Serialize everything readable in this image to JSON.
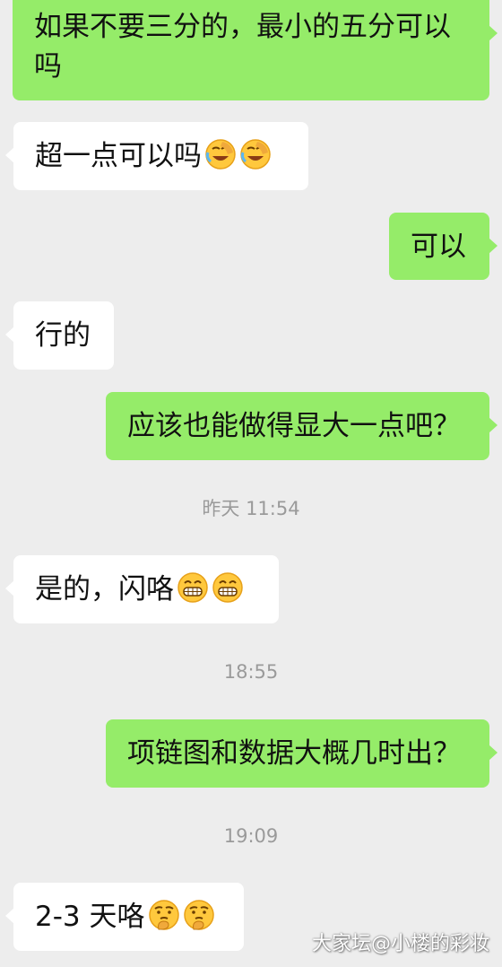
{
  "messages": [
    {
      "text": "如果不要三分的，最小的五分可以吗"
    },
    {
      "text": "超一点可以吗"
    },
    {
      "text": "可以"
    },
    {
      "text": "行的"
    },
    {
      "text": "应该也能做得显大一点吧？"
    },
    {
      "text": "是的，闪咯"
    },
    {
      "text": "项链图和数据大概几时出？"
    },
    {
      "text": "2-3 天咯"
    }
  ],
  "timestamps": [
    "昨天 11:54",
    "18:55",
    "19:09"
  ],
  "emojis": {
    "laugh_cry": "facepalm-laugh-icon",
    "grin": "grin-icon",
    "think": "thinking-icon"
  },
  "colors": {
    "sent_bubble": "#95ec69",
    "received_bubble": "#ffffff",
    "background": "#ededed",
    "timestamp": "#9a9a9a"
  },
  "watermark": "大家坛@小楼的彩妆"
}
